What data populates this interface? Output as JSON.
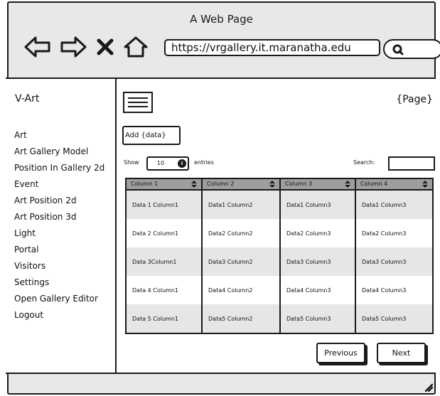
{
  "browser": {
    "title": "A Web Page",
    "url": "https://vrgallery.it.maranatha.edu"
  },
  "sidebar": {
    "brand": "V-Art",
    "items": [
      "Art",
      "Art Gallery Model",
      "Position In Gallery 2d",
      "Event",
      "Art Position 2d",
      "Art Position 3d",
      "Light",
      "Portal",
      "Visitors",
      "Settings",
      "Open Gallery Editor",
      "Logout"
    ]
  },
  "main": {
    "page_label": "{Page}",
    "add_button": "Add {data}",
    "show_label": "Show",
    "entries_value": "10",
    "entries_label": "entries",
    "search_label": "Search:",
    "table": {
      "columns": [
        "Column 1",
        "Column 2",
        "Column 3",
        "Column 4"
      ],
      "rows": [
        [
          "Data 1 Column1",
          "Data1 Column2",
          "Data1 Column3",
          "Data1 Column3"
        ],
        [
          "Data 2 Column1",
          "Data2 Column2",
          "Data2 Column3",
          "Data2 Column3"
        ],
        [
          "Data 3Column1",
          "Data3 Column2",
          "Data3 Column3",
          "Data3 Column3"
        ],
        [
          "Data 4 Column1",
          "Data4 Column2",
          "Data4 Column3",
          "Data4 Column3"
        ],
        [
          "Data 5 Column1",
          "Data5 Column2",
          "Data5 Column3",
          "Data5 Column3"
        ]
      ]
    },
    "previous_label": "Previous",
    "next_label": "Next"
  },
  "colors": {
    "chrome": "#e8e8e8",
    "header_bg": "#9e9e9e",
    "alt_row": "#e6e6e6",
    "ink": "#1a1a1a"
  }
}
